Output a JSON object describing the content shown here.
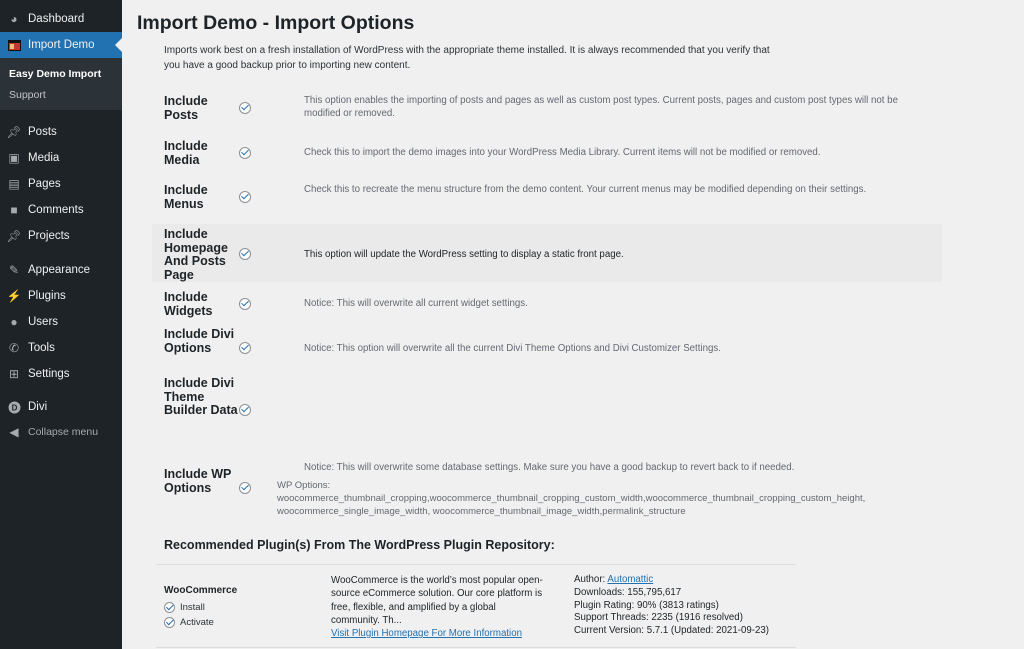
{
  "sidebar": {
    "dashboard": "Dashboard",
    "import_demo": "Import Demo",
    "submenu": [
      "Easy Demo Import",
      "Support"
    ],
    "items": [
      "Posts",
      "Media",
      "Pages",
      "Comments",
      "Projects",
      "Appearance",
      "Plugins",
      "Users",
      "Tools",
      "Settings",
      "Divi"
    ],
    "collapse": "Collapse menu"
  },
  "main": {
    "title": "Import Demo - Import Options",
    "intro": "Imports work best on a fresh installation of WordPress with the appropriate theme installed. It is always recommended that you verify that you have a good backup prior to importing new content.",
    "options": [
      {
        "label": "Include Posts",
        "checked": true,
        "desc": "This option enables the importing of posts and pages as well as custom post types. Current posts, pages and custom post types will not be modified or removed."
      },
      {
        "label": "Include Media",
        "checked": true,
        "desc": "Check this to import the demo images into your WordPress Media Library. Current items will not be modified or removed."
      },
      {
        "label": "Include Menus",
        "checked": true,
        "desc": "Check this to recreate the menu structure from the demo content. Your current menus may be modified depending on their settings."
      },
      {
        "label": "Include Homepage And Posts Page",
        "checked": true,
        "desc": "This option will update the WordPress setting to display a static front page."
      },
      {
        "label": "Include Widgets",
        "checked": true,
        "desc": "Notice: This will overwrite all current widget settings."
      },
      {
        "label": "Include Divi Options",
        "checked": true,
        "desc": "Notice: This option will overwrite all the current Divi Theme Options and Divi Customizer Settings."
      },
      {
        "label": "Include Divi Theme Builder Data",
        "checked": true,
        "desc": ""
      },
      {
        "label": "Include WP Options",
        "checked": true,
        "desc": "Notice: This will overwrite some database settings. Make sure you have a good backup to revert back to if needed."
      }
    ],
    "wp_options_label": "WP Options:",
    "wp_options_list": "woocommerce_thumbnail_cropping,woocommerce_thumbnail_cropping_custom_width,woocommerce_thumbnail_cropping_custom_height, woocommerce_single_image_width, woocommerce_thumbnail_image_width,permalink_structure",
    "recommended_heading": "Recommended Plugin(s) From The WordPress Plugin Repository:"
  },
  "plugin": {
    "name": "WooCommerce",
    "install": "Install",
    "activate": "Activate",
    "description": "WooCommerce is the world’s most popular open-source eCommerce solution. Our core platform is free, flexible, and amplified by a global community. Th...",
    "link": "Visit Plugin Homepage For More Information",
    "author_label": "Author:",
    "author": "Automattic",
    "downloads": "Downloads: 155,795,617",
    "rating": "Plugin Rating: 90% (3813 ratings)",
    "threads": "Support Threads: 2235 (1916 resolved)",
    "version": "Current Version: 5.7.1 (Updated: 2021-09-23)"
  }
}
